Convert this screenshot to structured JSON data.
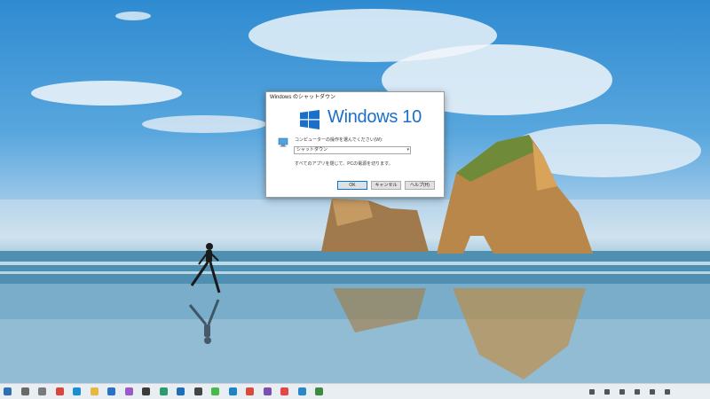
{
  "dialog": {
    "title": "Windows のシャットダウン",
    "brand": "Windows 10",
    "prompt": "コンピューターの操作を選んでください(W):",
    "selected_action": "シャットダウン",
    "description": "すべてのアプリを閉じて、PCの電源を切ります。",
    "buttons": {
      "ok": "OK",
      "cancel": "キャンセル",
      "help": "ヘルプ(H)"
    }
  },
  "taskbar": {
    "icons": [
      {
        "name": "start-icon",
        "color": "#2f6fb2"
      },
      {
        "name": "search-icon",
        "color": "#6a6a6a"
      },
      {
        "name": "task-view-icon",
        "color": "#7a7a7a"
      },
      {
        "name": "chrome-icon",
        "color": "#d9473c"
      },
      {
        "name": "edge-icon",
        "color": "#1a8fd1"
      },
      {
        "name": "file-explorer-icon",
        "color": "#e9b640"
      },
      {
        "name": "mail-icon",
        "color": "#2a72c8"
      },
      {
        "name": "paint-icon",
        "color": "#9c5ac8"
      },
      {
        "name": "app-icon-1",
        "color": "#3b3b3b"
      },
      {
        "name": "app-icon-2",
        "color": "#2c9c6d"
      },
      {
        "name": "app-icon-3",
        "color": "#1e6fb7"
      },
      {
        "name": "app-icon-4",
        "color": "#444444"
      },
      {
        "name": "app-icon-5",
        "color": "#49b94a"
      },
      {
        "name": "app-icon-6",
        "color": "#1d84c7"
      },
      {
        "name": "app-icon-7",
        "color": "#d94b3c"
      },
      {
        "name": "app-icon-8",
        "color": "#7b4fb0"
      },
      {
        "name": "app-icon-9",
        "color": "#e54646"
      },
      {
        "name": "app-icon-10",
        "color": "#2a88c9"
      },
      {
        "name": "app-icon-11",
        "color": "#3d8b40"
      }
    ],
    "tray": [
      "chevron-up-icon",
      "network-icon",
      "battery-icon",
      "volume-icon",
      "ime-icon",
      "notification-icon"
    ]
  }
}
